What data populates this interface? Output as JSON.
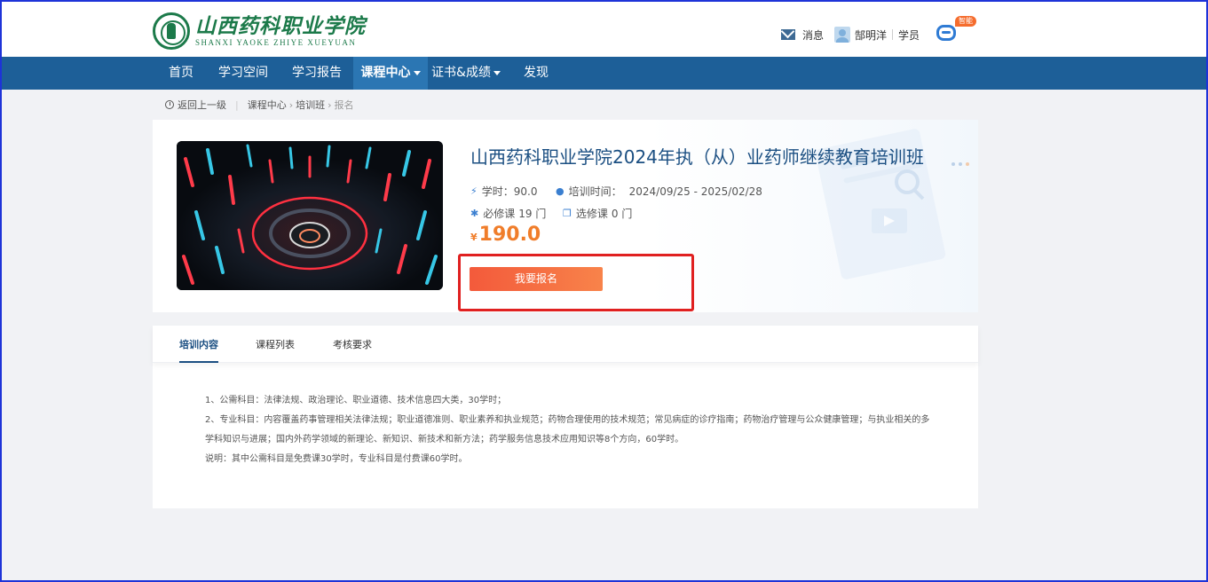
{
  "header": {
    "logo_cn": "山西药科职业学院",
    "logo_en": "SHANXI YAOKE ZHIYE XUEYUAN",
    "messages_label": "消息",
    "user_name": "郜明洋",
    "user_role": "学员",
    "assistant_badge": "智能"
  },
  "nav": {
    "items": [
      {
        "label": "首页"
      },
      {
        "label": "学习空间"
      },
      {
        "label": "学习报告"
      },
      {
        "label": "课程中心"
      },
      {
        "label": "证书&成绩"
      },
      {
        "label": "发现"
      }
    ],
    "active": "课程中心"
  },
  "breadcrumb": {
    "back": "返回上一级",
    "path": [
      "课程中心",
      "培训班"
    ],
    "current": "报名"
  },
  "course": {
    "title": "山西药科职业学院2024年执（从）业药师继续教育培训班",
    "hours_label": "学时：",
    "hours": "90.0",
    "period_label": "培训时间：",
    "period": "2024/09/25 - 2025/02/28",
    "required_label": "必修课",
    "required_count": "19 门",
    "elective_label": "选修课",
    "elective_count": "0 门",
    "currency": "¥",
    "price": "190.0",
    "enroll_button": "我要报名"
  },
  "tabs": {
    "items": [
      "培训内容",
      "课程列表",
      "考核要求"
    ],
    "active": "培训内容"
  },
  "content": {
    "lines": [
      "1、公需科目：法律法规、政治理论、职业道德、技术信息四大类，30学时；",
      "2、专业科目：内容覆盖药事管理相关法律法规；职业道德准则、职业素养和执业规范；药物合理使用的技术规范；常见病症的诊疗指南；药物治疗管理与公众健康管理；与执业相关的多学科知识与进展；国内外药学领域的新理论、新知识、新技术和新方法；药学服务信息技术应用知识等8个方向，60学时。",
      "说明：其中公需科目是免费课30学时，专业科目是付费课60学时。"
    ]
  },
  "colors": {
    "nav_bg": "#1d5f98",
    "nav_active": "#2b76b3",
    "title": "#1b4f82",
    "price": "#f07d2a",
    "button": "#f35a3b",
    "highlight": "#e02020"
  }
}
